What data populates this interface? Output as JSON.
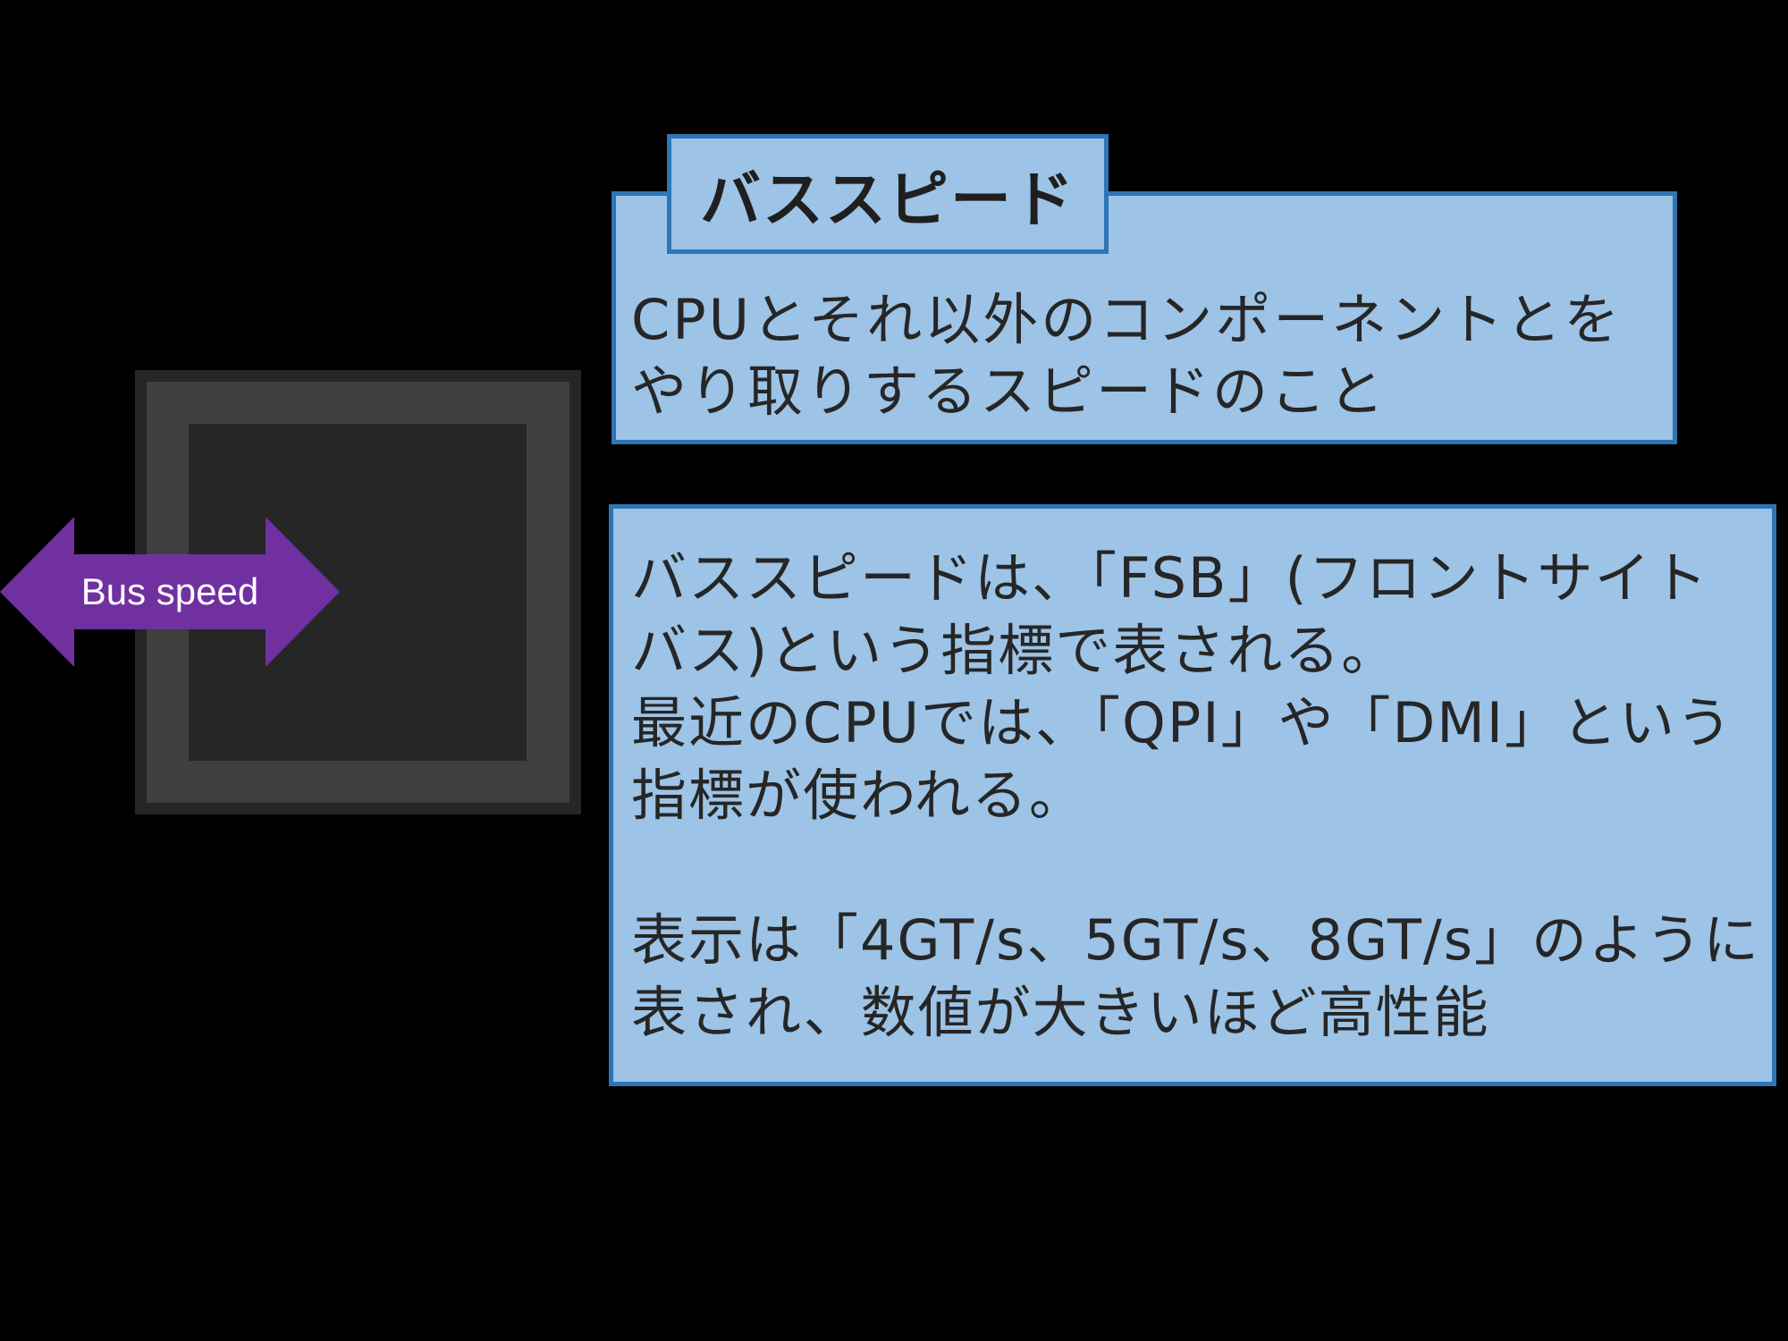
{
  "colors": {
    "background": "#000000",
    "chip_frame": "#3f3f3f",
    "chip_core": "#262626",
    "arrow_fill": "#7030a0",
    "panel_fill": "#9dc3e6",
    "panel_border": "#2e75b6",
    "text": "#262626"
  },
  "arrow": {
    "label": "Bus speed"
  },
  "definition": {
    "title": "バススピード",
    "text": "CPUとそれ以外のコンポーネントとをやり取りするスピードのこと"
  },
  "detail": {
    "lines": [
      "バススピードは、「FSB」(フロントサイト",
      "バス)という指標で表される。",
      "最近のCPUでは、「QPI」や「DMI」という",
      "指標が使われる。",
      "",
      "表示は「4GT/s、5GT/s、8GT/s」のように",
      "表され、数値が大きいほど高性能"
    ]
  }
}
